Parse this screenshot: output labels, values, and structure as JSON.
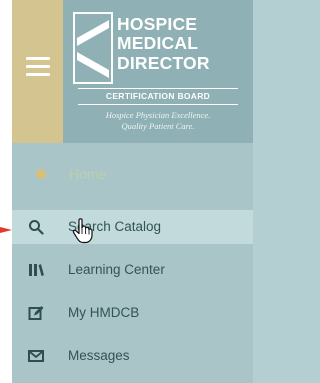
{
  "logo": {
    "line1": "HOSPICE",
    "line2": "MEDICAL",
    "line3": "DIRECTOR",
    "cert_line": "CERTIFICATION BOARD",
    "tagline1": "Hospice Physician Excellence.",
    "tagline2": "Quality Patient Care."
  },
  "nav": {
    "home_label": "Home",
    "items": [
      {
        "label": "Search Catalog",
        "icon": "search-icon",
        "active": true
      },
      {
        "label": "Learning Center",
        "icon": "library-icon"
      },
      {
        "label": "My HMDCB",
        "icon": "edit-icon"
      },
      {
        "label": "Messages",
        "icon": "envelope-icon"
      }
    ]
  },
  "colors": {
    "panel": "#a9c5c8",
    "header": "#8fb0b4",
    "hamburger_bg": "#d4c48f",
    "active_row": "#c2dadb",
    "text": "#335356",
    "pointer_arrow": "#e13a2a"
  }
}
